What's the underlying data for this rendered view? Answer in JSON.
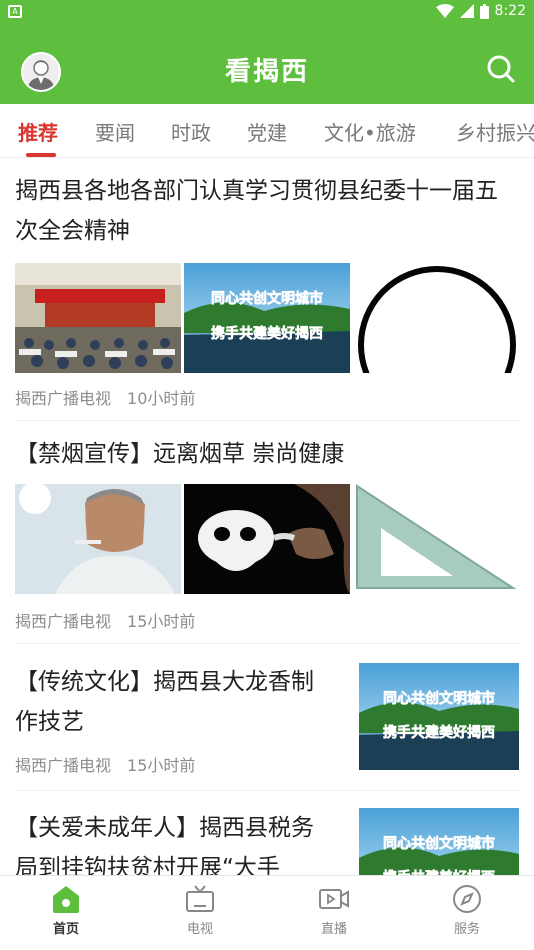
{
  "status": {
    "time": "8:22",
    "notif_icon": "A"
  },
  "header": {
    "title": "看揭西"
  },
  "tabs": [
    "推荐",
    "要闻",
    "时政",
    "党建",
    "文化•旅游",
    "乡村振兴"
  ],
  "articles": [
    {
      "title": "揭西县各地各部门认真学习贯彻县纪委十一届五次全会精神",
      "source": "揭西广播电视",
      "time": "10小时前"
    },
    {
      "title": "【禁烟宣传】远离烟草 崇尚健康",
      "source": "揭西广播电视",
      "time": "15小时前"
    },
    {
      "title": "【传统文化】揭西县大龙香制作技艺",
      "source": "揭西广播电视",
      "time": "15小时前"
    },
    {
      "title": "【关爱未成年人】揭西县税务局到挂钩扶贫村开展“大手",
      "source": "",
      "time": ""
    }
  ],
  "banner": {
    "line1": "同心共创文明城市",
    "line2": "携手共建美好揭西"
  },
  "bottom_nav": [
    "首页",
    "电视",
    "直播",
    "服务"
  ],
  "colors": {
    "brand_green": "#5ebf3f",
    "tab_active": "#d8362f"
  }
}
